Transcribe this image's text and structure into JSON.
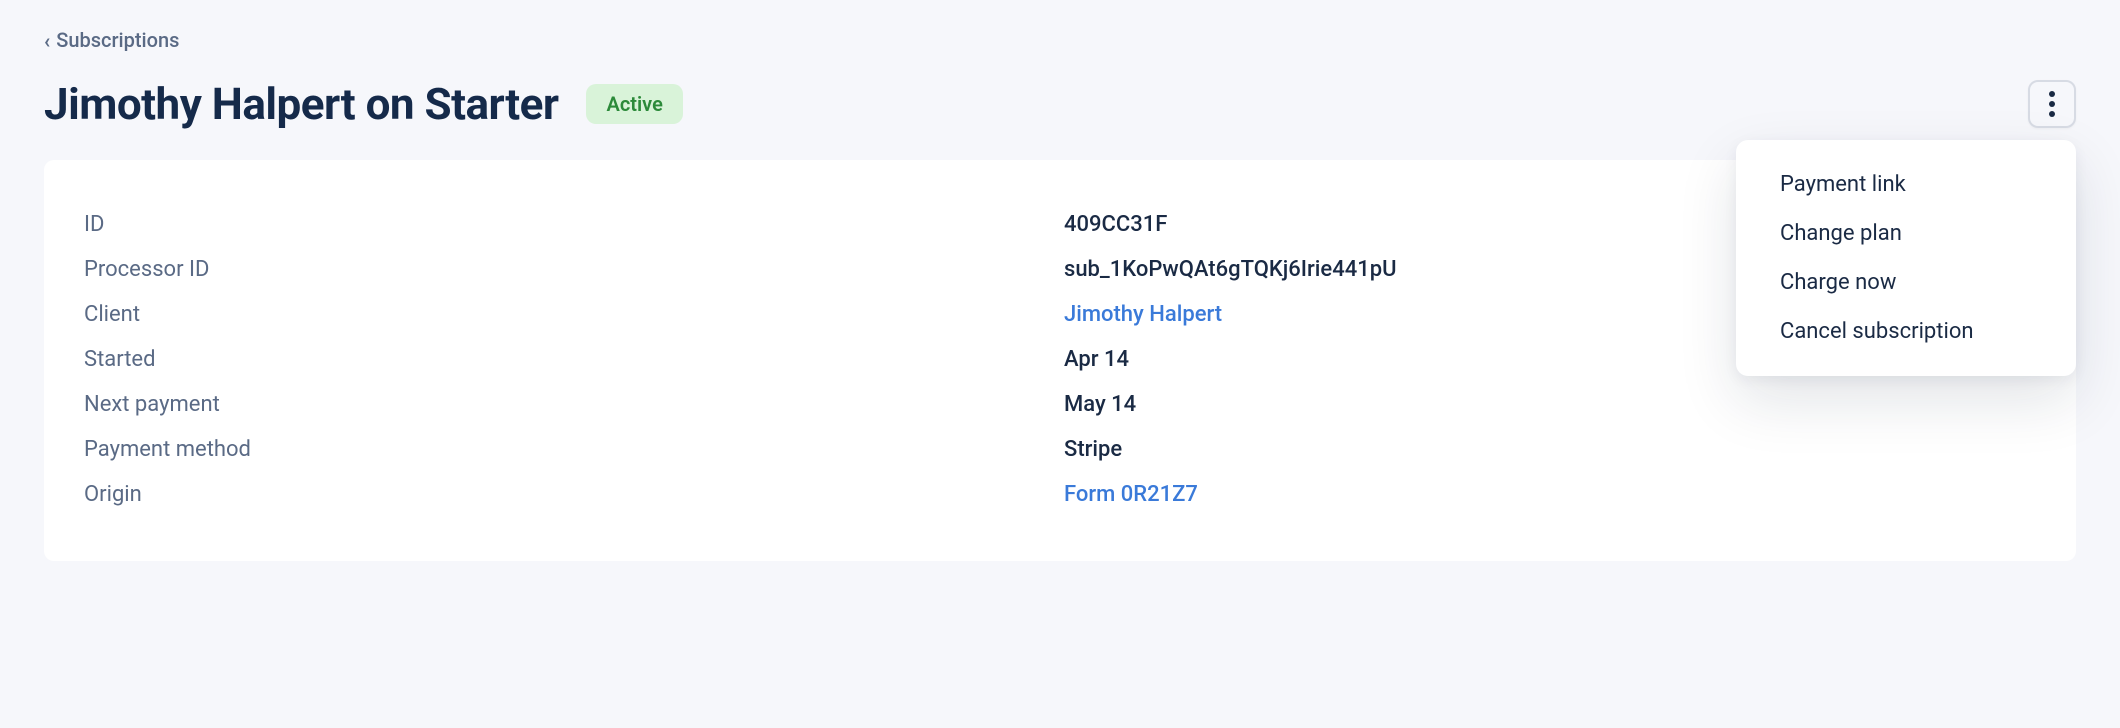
{
  "breadcrumb": {
    "label": "Subscriptions"
  },
  "header": {
    "title": "Jimothy Halpert on Starter",
    "status": "Active"
  },
  "menu": {
    "items": [
      {
        "label": "Payment link"
      },
      {
        "label": "Change plan"
      },
      {
        "label": "Charge now"
      },
      {
        "label": "Cancel subscription"
      }
    ]
  },
  "details": {
    "rows": [
      {
        "label": "ID",
        "value": "409CC31F",
        "link": false
      },
      {
        "label": "Processor ID",
        "value": "sub_1KoPwQAt6gTQKj6Irie441pU",
        "link": false
      },
      {
        "label": "Client",
        "value": "Jimothy Halpert",
        "link": true
      },
      {
        "label": "Started",
        "value": "Apr 14",
        "link": false
      },
      {
        "label": "Next payment",
        "value": "May 14",
        "link": false
      },
      {
        "label": "Payment method",
        "value": "Stripe",
        "link": false
      },
      {
        "label": "Origin",
        "value": "Form 0R21Z7",
        "link": true
      }
    ]
  }
}
